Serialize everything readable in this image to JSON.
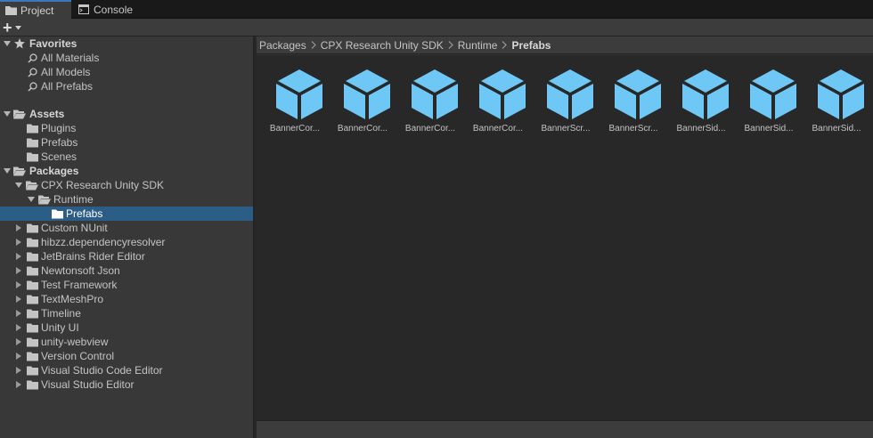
{
  "tabs": [
    {
      "label": "Project",
      "icon": "folder-icon"
    },
    {
      "label": "Console",
      "icon": "console-icon"
    }
  ],
  "toolbar": {
    "add_symbol": "+"
  },
  "tree": {
    "favorites": {
      "label": "Favorites",
      "items": [
        "All Materials",
        "All Models",
        "All Prefabs"
      ]
    },
    "assets": {
      "label": "Assets",
      "items": [
        "Plugins",
        "Prefabs",
        "Scenes"
      ]
    },
    "packages": {
      "label": "Packages",
      "cpx": "CPX Research Unity SDK",
      "runtime": "Runtime",
      "prefabs": "Prefabs",
      "others": [
        "Custom NUnit",
        "hibzz.dependencyresolver",
        "JetBrains Rider Editor",
        "Newtonsoft Json",
        "Test Framework",
        "TextMeshPro",
        "Timeline",
        "Unity UI",
        "unity-webview",
        "Version Control",
        "Visual Studio Code Editor",
        "Visual Studio Editor"
      ]
    }
  },
  "breadcrumb": [
    "Packages",
    "CPX Research Unity SDK",
    "Runtime",
    "Prefabs"
  ],
  "assets_grid": [
    "BannerCor...",
    "BannerCor...",
    "BannerCor...",
    "BannerCor...",
    "BannerScr...",
    "BannerScr...",
    "BannerSid...",
    "BannerSid...",
    "BannerSid..."
  ],
  "colors": {
    "prefab_icon": "#6fc7f5",
    "selection": "#2c5d87",
    "active_tab_accent": "#3a79bb"
  }
}
